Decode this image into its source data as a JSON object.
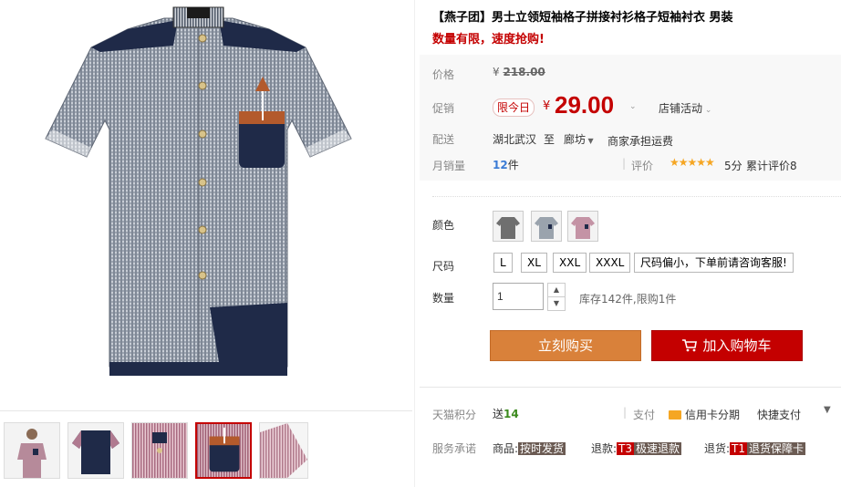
{
  "product": {
    "title": "【燕子团】男士立领短袖格子拼接衬衫格子短袖衬衣 男装",
    "subtitle": "数量有限，速度抢购!"
  },
  "price": {
    "label": "价格",
    "currency": "¥",
    "original": "218.00"
  },
  "promo": {
    "label": "促销",
    "badge": "限今日",
    "currency": "¥",
    "price": "29.00",
    "store_activity": "店铺活动"
  },
  "shipping": {
    "label": "配送",
    "from": "湖北武汉",
    "to_word": "至",
    "destination": "廊坊",
    "freight": "商家承担运费"
  },
  "sales": {
    "label": "月销量",
    "count": "12",
    "unit": "件",
    "rating_label": "评价",
    "stars": "★★★★★",
    "score": "5分",
    "total_reviews": "累计评价8"
  },
  "sku": {
    "color_label": "颜色",
    "colors": [
      "dark gray",
      "light gray",
      "pink"
    ],
    "size_label": "尺码",
    "sizes": [
      "L",
      "XL",
      "XXL",
      "XXXL",
      "尺码偏小，下单前请咨询客服!"
    ],
    "qty_label": "数量",
    "qty_value": "1",
    "stock_note": "库存142件,限购1件"
  },
  "actions": {
    "buy_now": "立刻购买",
    "add_to_cart": "加入购物车"
  },
  "points": {
    "label": "天猫积分",
    "give": "送",
    "amount": "14",
    "pay_label": "支付",
    "credit_installment": "信用卡分期",
    "quick_pay": "快捷支付"
  },
  "service": {
    "label": "服务承诺",
    "goods_prefix": "商品:",
    "goods_tag": "按时发货",
    "refund_prefix": "退款:",
    "refund_code": "T3",
    "refund_tag": "极速退款",
    "return_prefix": "退货:",
    "return_code": "T1",
    "return_tag": "退货保障卡"
  },
  "colors": {
    "accent_red": "#c40000",
    "buy_orange": "#d9813a",
    "star_gold": "#f5a623"
  }
}
